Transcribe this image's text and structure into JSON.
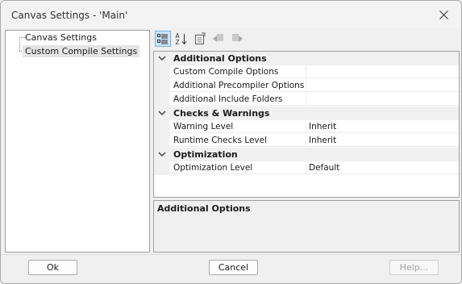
{
  "window": {
    "title": "Canvas Settings - 'Main'"
  },
  "tree": {
    "items": [
      {
        "label": "Canvas Settings",
        "selected": false
      },
      {
        "label": "Custom Compile Settings",
        "selected": true
      }
    ]
  },
  "toolbar": {
    "buttons": [
      {
        "icon": "categorized-icon",
        "active": true
      },
      {
        "icon": "alphabetical-sort-icon",
        "active": false
      },
      {
        "icon": "property-pages-icon",
        "active": false
      },
      {
        "icon": "back-icon",
        "active": false
      },
      {
        "icon": "forward-icon",
        "active": false
      }
    ]
  },
  "grid": {
    "categories": [
      {
        "label": "Additional Options",
        "properties": [
          {
            "name": "Custom Compile Options",
            "value": ""
          },
          {
            "name": "Additional Precompiler Options",
            "value": ""
          },
          {
            "name": "Additional Include Folders",
            "value": ""
          }
        ]
      },
      {
        "label": "Checks & Warnings",
        "properties": [
          {
            "name": "Warning Level",
            "value": "Inherit"
          },
          {
            "name": "Runtime Checks Level",
            "value": "Inherit"
          }
        ]
      },
      {
        "label": "Optimization",
        "properties": [
          {
            "name": "Optimization Level",
            "value": "Default"
          }
        ]
      }
    ]
  },
  "description": {
    "title": "Additional Options"
  },
  "buttons": {
    "ok": "Ok",
    "cancel": "Cancel",
    "help": "Help..."
  }
}
